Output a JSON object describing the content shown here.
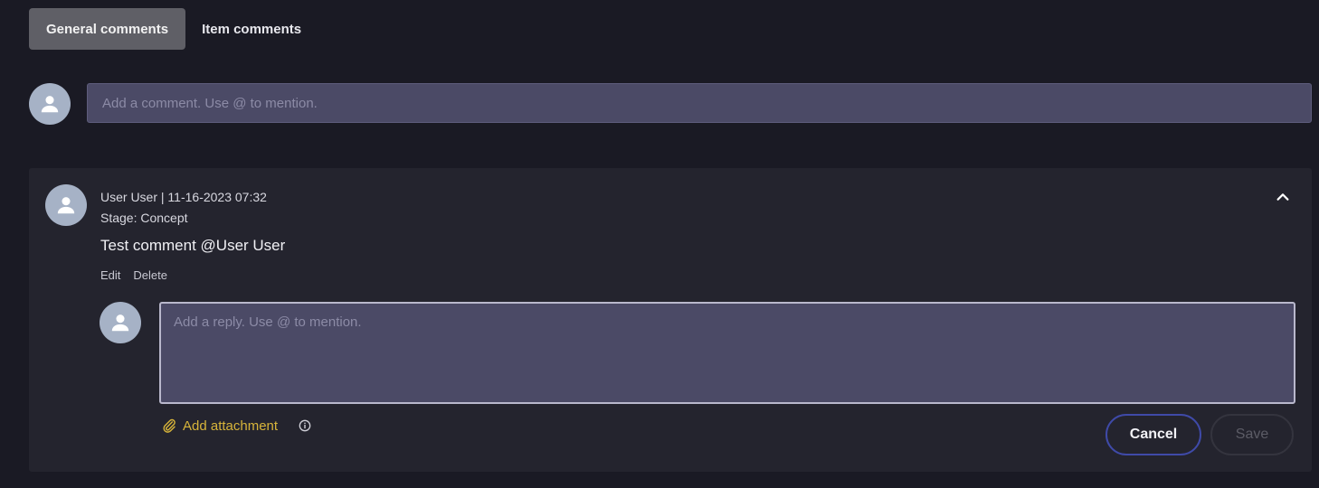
{
  "tabs": [
    {
      "label": "General comments",
      "active": true
    },
    {
      "label": "Item comments",
      "active": false
    }
  ],
  "comment_input": {
    "placeholder": "Add a comment. Use @ to mention.",
    "value": ""
  },
  "comment": {
    "author_line": "User User | 11-16-2023 07:32",
    "stage_line": "Stage: Concept",
    "text": "Test comment @User User",
    "edit_label": "Edit",
    "delete_label": "Delete"
  },
  "reply": {
    "placeholder": "Add a reply. Use @ to mention.",
    "value": "",
    "add_attachment_label": "Add attachment",
    "cancel_label": "Cancel",
    "save_label": "Save"
  },
  "icons": {
    "avatar": "user-silhouette-icon",
    "collapse": "chevron-up-icon",
    "attachment": "paperclip-icon",
    "info": "info-circle-icon"
  },
  "colors": {
    "background": "#1a1a24",
    "card": "#24242e",
    "input": "#4b4a66",
    "accent_gold": "#d7b43a",
    "cancel_border": "#3f4aa8",
    "active_tab": "#5f5f66"
  }
}
